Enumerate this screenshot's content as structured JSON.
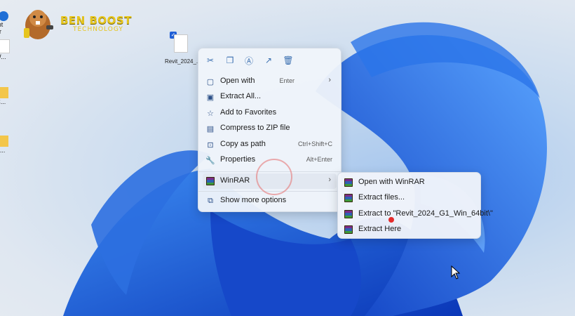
{
  "branding": {
    "logo_title": "BEN BOOST",
    "logo_subtitle": "TECHNOLOGY"
  },
  "desktop": {
    "left_labels": [
      "ont",
      "er",
      "AW...",
      "RC...",
      "P -..."
    ],
    "file_label": "Revit_2024_..."
  },
  "context_menu": {
    "icon_bar": [
      "cut-icon",
      "copy-icon",
      "rename-icon",
      "share-icon",
      "delete-icon"
    ],
    "items": [
      {
        "label": "Open with",
        "shortcut": "Enter",
        "has_submenu": true,
        "icon": "open-with-icon"
      },
      {
        "label": "Extract All...",
        "shortcut": "",
        "has_submenu": false,
        "icon": "extract-all-icon"
      },
      {
        "label": "Add to Favorites",
        "shortcut": "",
        "has_submenu": false,
        "icon": "star-icon"
      },
      {
        "label": "Compress to ZIP file",
        "shortcut": "",
        "has_submenu": false,
        "icon": "zip-icon"
      },
      {
        "label": "Copy as path",
        "shortcut": "Ctrl+Shift+C",
        "has_submenu": false,
        "icon": "path-icon"
      },
      {
        "label": "Properties",
        "shortcut": "Alt+Enter",
        "has_submenu": false,
        "icon": "wrench-icon"
      },
      {
        "label": "WinRAR",
        "shortcut": "",
        "has_submenu": true,
        "icon": "winrar-icon"
      },
      {
        "label": "Show more options",
        "shortcut": "",
        "has_submenu": false,
        "icon": "more-options-icon"
      }
    ]
  },
  "winrar_submenu": {
    "items": [
      {
        "label": "Open with WinRAR"
      },
      {
        "label": "Extract files..."
      },
      {
        "label": "Extract to \"Revit_2024_G1_Win_64bit\\\""
      },
      {
        "label": "Extract Here"
      }
    ]
  },
  "colors": {
    "accent": "#1f5fd6",
    "menu_bg": "#f0f4fa"
  }
}
